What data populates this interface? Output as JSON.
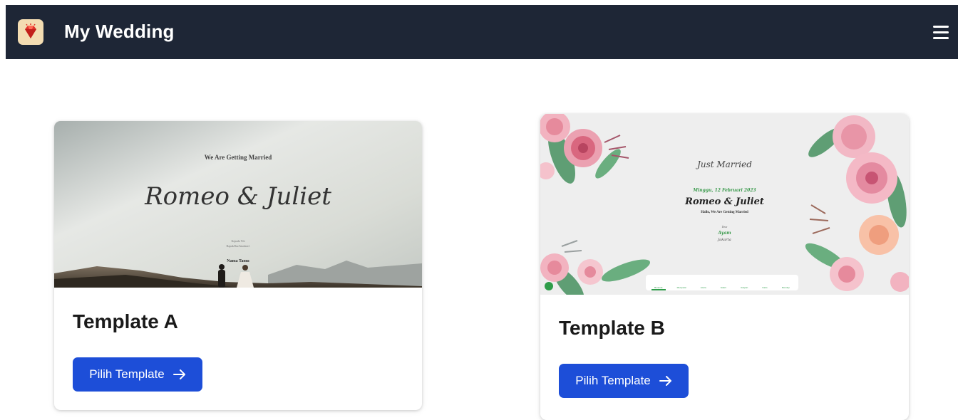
{
  "app": {
    "title": "My Wedding",
    "logo_icon": "diamond-icon",
    "menu_icon": "hamburger-menu-icon"
  },
  "colors": {
    "navbar": "#1e2636",
    "button": "#1d4ed8",
    "logo_bg": "#f3dcb2",
    "logo_gem": "#e0322b"
  },
  "templates": [
    {
      "title": "Template A",
      "button_label": "Pilih Template",
      "preview": {
        "heading": "We Are Getting Married",
        "names": "Romeo & Juliet",
        "line1": "Kepada Yth",
        "line2": "Bapak/Ibu/Saudara/i",
        "guest": "Nama Tamu"
      }
    },
    {
      "title": "Template B",
      "button_label": "Pilih Template",
      "preview": {
        "badge": "Just Married",
        "date": "Minggu, 12 Februari 2023",
        "names": "Romeo & Juliet",
        "subtitle": "Hallo, We Are Getting Married",
        "to": "Dear",
        "guest": "Ayam",
        "city": "Jakarta",
        "nav": [
          "Beranda",
          "Mempelai",
          "Acara",
          "Galeri",
          "Ucapan",
          "Kado",
          "Penutup"
        ]
      }
    }
  ]
}
